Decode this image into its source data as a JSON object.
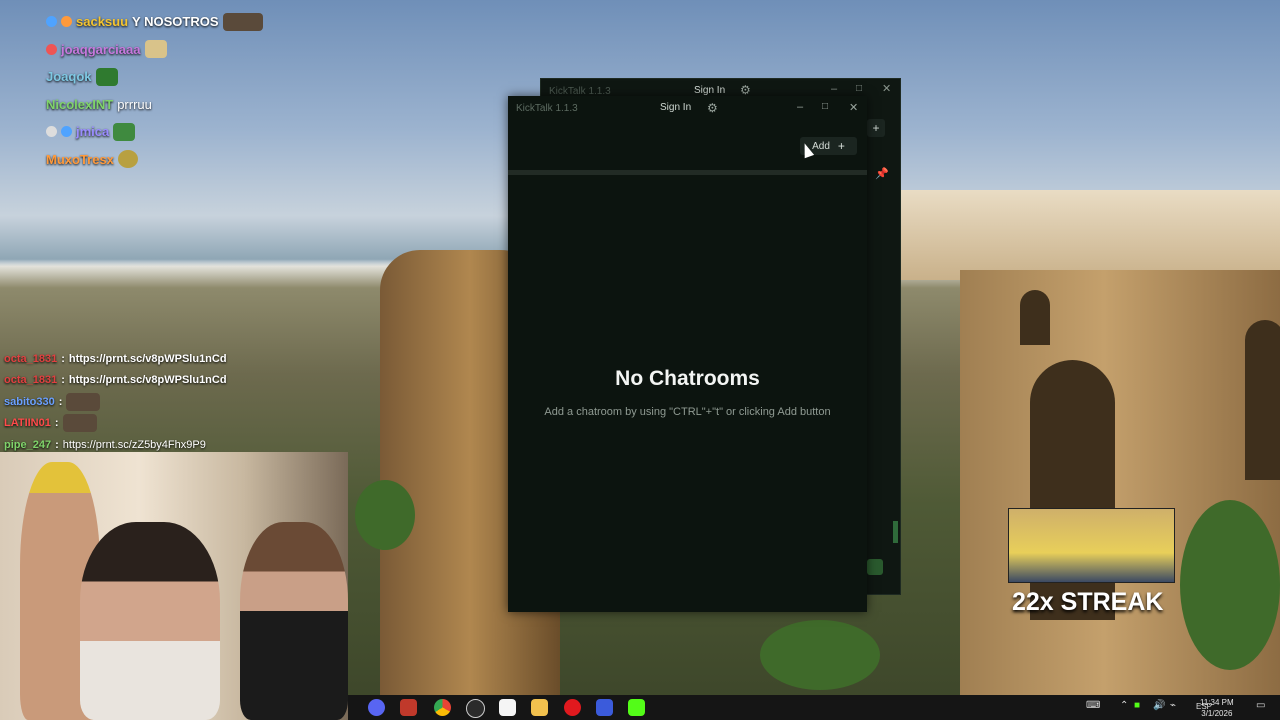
{
  "overlay_chat": [
    {
      "user": "sacksuu",
      "message": "Y NOSOTROS",
      "color": "#f4c430"
    },
    {
      "user": "joaqgarciaaa",
      "message": "",
      "color": "#c678dd"
    },
    {
      "user": "Joaqok",
      "message": "",
      "color": "#7ec8e3"
    },
    {
      "user": "NicolexINT",
      "message": "prrruu",
      "color": "#7fd36a"
    },
    {
      "user": "jmica",
      "message": "",
      "color": "#7aa2ff"
    },
    {
      "user": "MuxoTresx",
      "message": "",
      "color": "#ff9a3c"
    }
  ],
  "overlay_links": [
    {
      "user": "octa_1831",
      "message": "https://prnt.sc/v8pWPSlu1nCd",
      "color": "#4ad36a"
    },
    {
      "user": "octa_1831",
      "message": "https://prnt.sc/v8pWPSlu1nCd",
      "color": "#ff4a4a"
    },
    {
      "user": "sabito330",
      "message": "",
      "color": "#6aa0ff"
    },
    {
      "user": "LATIIN01",
      "message": "",
      "color": "#ff4a4a"
    },
    {
      "user": "pipe_247",
      "message": "https://prnt.sc/zZ5by4Fhx9P9",
      "color": "#7fd36a"
    }
  ],
  "back_window": {
    "title": "KickTalk 1.1.3",
    "signin_label": "Sign In",
    "add_icon": "+"
  },
  "window": {
    "title": "KickTalk 1.1.3",
    "signin_label": "Sign In",
    "settings_icon": "gear-icon",
    "add_label": "Add",
    "add_icon": "+",
    "empty_title": "No Chatrooms",
    "empty_subtitle": "Add a chatroom by using \"CTRL\"+\"t\" or clicking Add button"
  },
  "streak": {
    "text": "22x STREAK"
  },
  "taskbar": {
    "lang": "ESP",
    "time": "11:34 PM",
    "date": "3/1/2026",
    "apps": [
      "discord-icon",
      "vencord-icon",
      "chrome-icon",
      "obs-icon",
      "notion-icon",
      "explorer-icon",
      "opera-icon",
      "visual-studio-icon",
      "kick-icon"
    ]
  },
  "colors": {
    "accent": "#53fc18",
    "window_bg": "#0c140f"
  }
}
